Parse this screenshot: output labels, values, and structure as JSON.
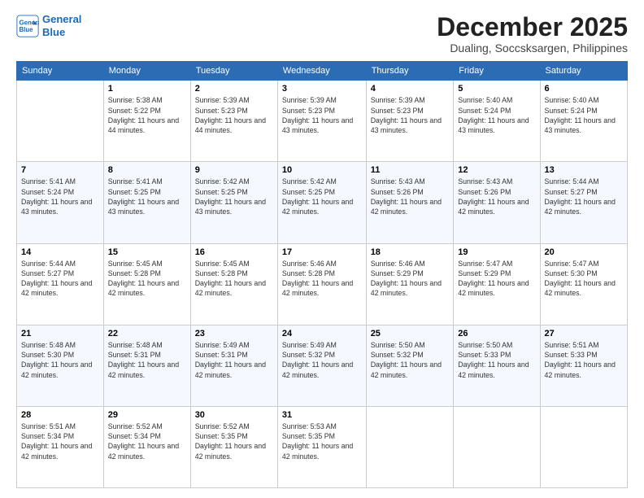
{
  "logo": {
    "line1": "General",
    "line2": "Blue"
  },
  "title": "December 2025",
  "location": "Dualing, Soccsksargen, Philippines",
  "days_of_week": [
    "Sunday",
    "Monday",
    "Tuesday",
    "Wednesday",
    "Thursday",
    "Friday",
    "Saturday"
  ],
  "weeks": [
    [
      {
        "day": "",
        "sunrise": "",
        "sunset": "",
        "daylight": ""
      },
      {
        "day": "1",
        "sunrise": "Sunrise: 5:38 AM",
        "sunset": "Sunset: 5:22 PM",
        "daylight": "Daylight: 11 hours and 44 minutes."
      },
      {
        "day": "2",
        "sunrise": "Sunrise: 5:39 AM",
        "sunset": "Sunset: 5:23 PM",
        "daylight": "Daylight: 11 hours and 44 minutes."
      },
      {
        "day": "3",
        "sunrise": "Sunrise: 5:39 AM",
        "sunset": "Sunset: 5:23 PM",
        "daylight": "Daylight: 11 hours and 43 minutes."
      },
      {
        "day": "4",
        "sunrise": "Sunrise: 5:39 AM",
        "sunset": "Sunset: 5:23 PM",
        "daylight": "Daylight: 11 hours and 43 minutes."
      },
      {
        "day": "5",
        "sunrise": "Sunrise: 5:40 AM",
        "sunset": "Sunset: 5:24 PM",
        "daylight": "Daylight: 11 hours and 43 minutes."
      },
      {
        "day": "6",
        "sunrise": "Sunrise: 5:40 AM",
        "sunset": "Sunset: 5:24 PM",
        "daylight": "Daylight: 11 hours and 43 minutes."
      }
    ],
    [
      {
        "day": "7",
        "sunrise": "Sunrise: 5:41 AM",
        "sunset": "Sunset: 5:24 PM",
        "daylight": "Daylight: 11 hours and 43 minutes."
      },
      {
        "day": "8",
        "sunrise": "Sunrise: 5:41 AM",
        "sunset": "Sunset: 5:25 PM",
        "daylight": "Daylight: 11 hours and 43 minutes."
      },
      {
        "day": "9",
        "sunrise": "Sunrise: 5:42 AM",
        "sunset": "Sunset: 5:25 PM",
        "daylight": "Daylight: 11 hours and 43 minutes."
      },
      {
        "day": "10",
        "sunrise": "Sunrise: 5:42 AM",
        "sunset": "Sunset: 5:25 PM",
        "daylight": "Daylight: 11 hours and 42 minutes."
      },
      {
        "day": "11",
        "sunrise": "Sunrise: 5:43 AM",
        "sunset": "Sunset: 5:26 PM",
        "daylight": "Daylight: 11 hours and 42 minutes."
      },
      {
        "day": "12",
        "sunrise": "Sunrise: 5:43 AM",
        "sunset": "Sunset: 5:26 PM",
        "daylight": "Daylight: 11 hours and 42 minutes."
      },
      {
        "day": "13",
        "sunrise": "Sunrise: 5:44 AM",
        "sunset": "Sunset: 5:27 PM",
        "daylight": "Daylight: 11 hours and 42 minutes."
      }
    ],
    [
      {
        "day": "14",
        "sunrise": "Sunrise: 5:44 AM",
        "sunset": "Sunset: 5:27 PM",
        "daylight": "Daylight: 11 hours and 42 minutes."
      },
      {
        "day": "15",
        "sunrise": "Sunrise: 5:45 AM",
        "sunset": "Sunset: 5:28 PM",
        "daylight": "Daylight: 11 hours and 42 minutes."
      },
      {
        "day": "16",
        "sunrise": "Sunrise: 5:45 AM",
        "sunset": "Sunset: 5:28 PM",
        "daylight": "Daylight: 11 hours and 42 minutes."
      },
      {
        "day": "17",
        "sunrise": "Sunrise: 5:46 AM",
        "sunset": "Sunset: 5:28 PM",
        "daylight": "Daylight: 11 hours and 42 minutes."
      },
      {
        "day": "18",
        "sunrise": "Sunrise: 5:46 AM",
        "sunset": "Sunset: 5:29 PM",
        "daylight": "Daylight: 11 hours and 42 minutes."
      },
      {
        "day": "19",
        "sunrise": "Sunrise: 5:47 AM",
        "sunset": "Sunset: 5:29 PM",
        "daylight": "Daylight: 11 hours and 42 minutes."
      },
      {
        "day": "20",
        "sunrise": "Sunrise: 5:47 AM",
        "sunset": "Sunset: 5:30 PM",
        "daylight": "Daylight: 11 hours and 42 minutes."
      }
    ],
    [
      {
        "day": "21",
        "sunrise": "Sunrise: 5:48 AM",
        "sunset": "Sunset: 5:30 PM",
        "daylight": "Daylight: 11 hours and 42 minutes."
      },
      {
        "day": "22",
        "sunrise": "Sunrise: 5:48 AM",
        "sunset": "Sunset: 5:31 PM",
        "daylight": "Daylight: 11 hours and 42 minutes."
      },
      {
        "day": "23",
        "sunrise": "Sunrise: 5:49 AM",
        "sunset": "Sunset: 5:31 PM",
        "daylight": "Daylight: 11 hours and 42 minutes."
      },
      {
        "day": "24",
        "sunrise": "Sunrise: 5:49 AM",
        "sunset": "Sunset: 5:32 PM",
        "daylight": "Daylight: 11 hours and 42 minutes."
      },
      {
        "day": "25",
        "sunrise": "Sunrise: 5:50 AM",
        "sunset": "Sunset: 5:32 PM",
        "daylight": "Daylight: 11 hours and 42 minutes."
      },
      {
        "day": "26",
        "sunrise": "Sunrise: 5:50 AM",
        "sunset": "Sunset: 5:33 PM",
        "daylight": "Daylight: 11 hours and 42 minutes."
      },
      {
        "day": "27",
        "sunrise": "Sunrise: 5:51 AM",
        "sunset": "Sunset: 5:33 PM",
        "daylight": "Daylight: 11 hours and 42 minutes."
      }
    ],
    [
      {
        "day": "28",
        "sunrise": "Sunrise: 5:51 AM",
        "sunset": "Sunset: 5:34 PM",
        "daylight": "Daylight: 11 hours and 42 minutes."
      },
      {
        "day": "29",
        "sunrise": "Sunrise: 5:52 AM",
        "sunset": "Sunset: 5:34 PM",
        "daylight": "Daylight: 11 hours and 42 minutes."
      },
      {
        "day": "30",
        "sunrise": "Sunrise: 5:52 AM",
        "sunset": "Sunset: 5:35 PM",
        "daylight": "Daylight: 11 hours and 42 minutes."
      },
      {
        "day": "31",
        "sunrise": "Sunrise: 5:53 AM",
        "sunset": "Sunset: 5:35 PM",
        "daylight": "Daylight: 11 hours and 42 minutes."
      },
      {
        "day": "",
        "sunrise": "",
        "sunset": "",
        "daylight": ""
      },
      {
        "day": "",
        "sunrise": "",
        "sunset": "",
        "daylight": ""
      },
      {
        "day": "",
        "sunrise": "",
        "sunset": "",
        "daylight": ""
      }
    ]
  ]
}
